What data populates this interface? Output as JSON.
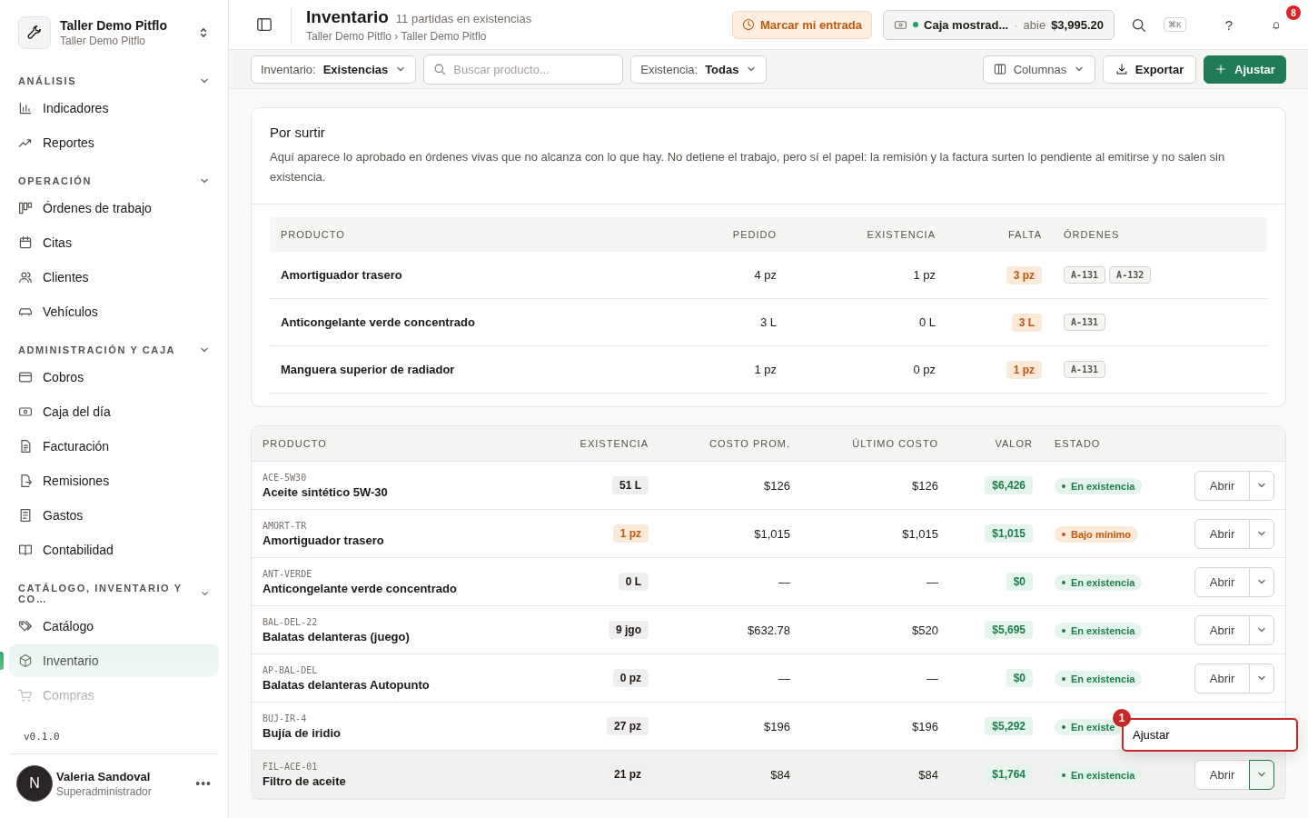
{
  "sidebar": {
    "workspace": {
      "name": "Taller Demo Pitflo",
      "subtitle": "Taller Demo Pitflo"
    },
    "sections": [
      {
        "title": "ANÁLISIS",
        "items": [
          {
            "label": "Indicadores",
            "selected": false
          },
          {
            "label": "Reportes",
            "selected": false
          }
        ]
      },
      {
        "title": "OPERACIÓN",
        "items": [
          {
            "label": "Órdenes de trabajo",
            "selected": false
          },
          {
            "label": "Citas",
            "selected": false
          },
          {
            "label": "Clientes",
            "selected": false
          },
          {
            "label": "Vehículos",
            "selected": false
          }
        ]
      },
      {
        "title": "ADMINISTRACIÓN Y CAJA",
        "items": [
          {
            "label": "Cobros",
            "selected": false
          },
          {
            "label": "Caja del día",
            "selected": false
          },
          {
            "label": "Facturación",
            "selected": false
          },
          {
            "label": "Remisiones",
            "selected": false
          },
          {
            "label": "Gastos",
            "selected": false
          },
          {
            "label": "Contabilidad",
            "selected": false
          }
        ]
      },
      {
        "title": "CATÁLOGO, INVENTARIO Y CO…",
        "items": [
          {
            "label": "Catálogo",
            "selected": false
          },
          {
            "label": "Inventario",
            "selected": true
          },
          {
            "label": "Compras",
            "selected": false
          }
        ]
      }
    ],
    "version": "v0.1.0",
    "user": {
      "initial": "N",
      "name": "Valeria Sandoval",
      "role": "Superadministrador",
      "more": "•••"
    }
  },
  "header": {
    "title": "Inventario",
    "subtitle": "11 partidas en existencias",
    "breadcrumb": [
      "Taller Demo Pitflo",
      "Taller Demo Pitflo"
    ],
    "breadcrumb_separator": "›",
    "clock_in": "Marcar mi entrada",
    "register": {
      "name": "Caja mostrad...",
      "open": true,
      "separator": "·",
      "status": "abie",
      "amount": "$3,995.20"
    },
    "shortcut": "⌘K",
    "help": "?",
    "notifications": "8"
  },
  "toolbar": {
    "filters": [
      {
        "label": "Inventario:",
        "value": "Existencias"
      }
    ],
    "search": {
      "placeholder": "Buscar producto..."
    },
    "stock_filter": {
      "label": "Existencia:",
      "value": "Todas"
    },
    "columns_button": "Columnas",
    "export_button": "Exportar",
    "adjust_button": "Ajustar"
  },
  "pending": {
    "title": "Por surtir",
    "description": "Aquí aparece lo aprobado en órdenes vivas que no alcanza con lo que hay. No detiene el trabajo, pero sí el papel: la remisión y la factura surten lo pendiente al emitirse y no salen sin existencia.",
    "columns": [
      "PRODUCTO",
      "PEDIDO",
      "EXISTENCIA",
      "FALTA",
      "ÓRDENES"
    ],
    "rows": [
      {
        "product": "Amortiguador trasero",
        "ordered": "4 pz",
        "stock": "1 pz",
        "missing": "3 pz",
        "orders": [
          "A-131",
          "A-132"
        ]
      },
      {
        "product": "Anticongelante verde concentrado",
        "ordered": "3 L",
        "stock": "0 L",
        "missing": "3 L",
        "orders": [
          "A-131"
        ]
      },
      {
        "product": "Manguera superior de radiador",
        "ordered": "1 pz",
        "stock": "0 pz",
        "missing": "1 pz",
        "orders": [
          "A-131"
        ]
      }
    ]
  },
  "inventory": {
    "columns": [
      "PRODUCTO",
      "EXISTENCIA",
      "COSTO PROM.",
      "ÚLTIMO COSTO",
      "VALOR",
      "ESTADO"
    ],
    "rows": [
      {
        "sku": "ACE-5W30",
        "name": "Aceite sintético 5W-30",
        "stock": "51 L",
        "low": false,
        "avg_cost": "$126",
        "last_cost": "$126",
        "value": "$6,426",
        "status": "En existencia",
        "hovered": false,
        "menu_open": false,
        "open_label": "Abrir"
      },
      {
        "sku": "AMORT-TR",
        "name": "Amortiguador trasero",
        "stock": "1 pz",
        "low": true,
        "avg_cost": "$1,015",
        "last_cost": "$1,015",
        "value": "$1,015",
        "status": "Bajo mínimo",
        "hovered": false,
        "menu_open": false,
        "open_label": "Abrir"
      },
      {
        "sku": "ANT-VERDE",
        "name": "Anticongelante verde concentrado",
        "stock": "0 L",
        "low": false,
        "avg_cost": "—",
        "last_cost": "—",
        "value": "$0",
        "status": "En existencia",
        "hovered": false,
        "menu_open": false,
        "open_label": "Abrir"
      },
      {
        "sku": "BAL-DEL-22",
        "name": "Balatas delanteras (juego)",
        "stock": "9 jgo",
        "low": false,
        "avg_cost": "$632.78",
        "last_cost": "$520",
        "value": "$5,695",
        "status": "En existencia",
        "hovered": false,
        "menu_open": false,
        "open_label": "Abrir"
      },
      {
        "sku": "AP-BAL-DEL",
        "name": "Balatas delanteras Autopunto",
        "stock": "0 pz",
        "low": false,
        "avg_cost": "—",
        "last_cost": "—",
        "value": "$0",
        "status": "En existencia",
        "hovered": false,
        "menu_open": false,
        "open_label": "Abrir"
      },
      {
        "sku": "BUJ-IR-4",
        "name": "Bujía de iridio",
        "stock": "27 pz",
        "low": false,
        "avg_cost": "$196",
        "last_cost": "$196",
        "value": "$5,292",
        "status": "En existe",
        "hovered": false
      },
      {
        "sku": "FIL-ACE-01",
        "name": "Filtro de aceite",
        "stock": "21 pz",
        "low": false,
        "avg_cost": "$84",
        "last_cost": "$84",
        "value": "$1,764",
        "status": "En existencia",
        "hovered": true,
        "menu_open": true,
        "open_label": "Abrir"
      }
    ],
    "menu": {
      "items": [
        "Ajustar"
      ],
      "marker": "1"
    }
  }
}
